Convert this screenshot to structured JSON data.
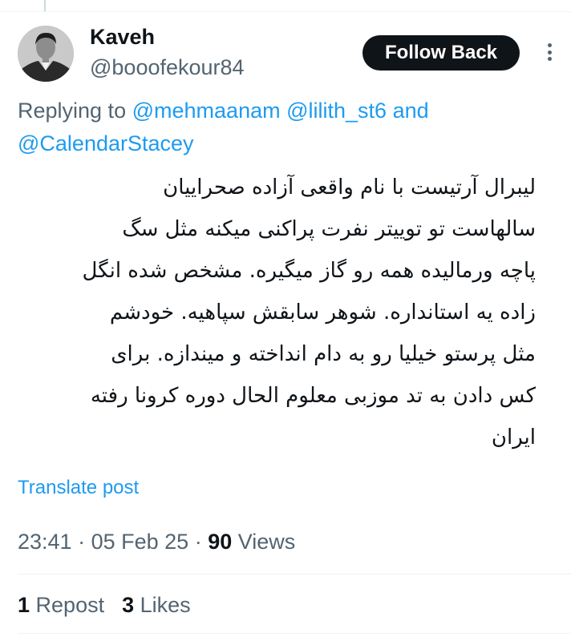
{
  "post": {
    "display_name": "Kaveh",
    "handle": "@booofekour84",
    "follow_label": "Follow Back",
    "more_icon": "more-icon",
    "replying_prefix": "Replying to",
    "mentions": [
      "@mehmaanam",
      "@lilith_st6",
      "@CalendarStacey"
    ],
    "mention_joiner": "and",
    "body": "لیبرال آرتیست با نام واقعی آزاده صحراییان\nسالهاست تو توییتر نفرت پراکنی میکنه مثل سگ\nپاچه ورمالیده همه رو گاز میگیره. مشخص شده انگل\nزاده یه استانداره. شوهر سابقش سپاهیه. خودشم\nمثل پرستو خیلیا رو به دام انداخته و میندازه. برای\nکس دادن به تد موزبی معلوم الحال دوره کرونا رفته\nایران",
    "translate_label": "Translate post",
    "time": "23:41",
    "date": "05 Feb 25",
    "views_count": "90",
    "views_label": "Views",
    "reposts_count": "1",
    "reposts_label": "Repost",
    "likes_count": "3",
    "likes_label": "Likes"
  },
  "colors": {
    "accent": "#1d9bf0",
    "text": "#0f1419",
    "secondary": "#536471",
    "button_bg": "#0f1419"
  }
}
